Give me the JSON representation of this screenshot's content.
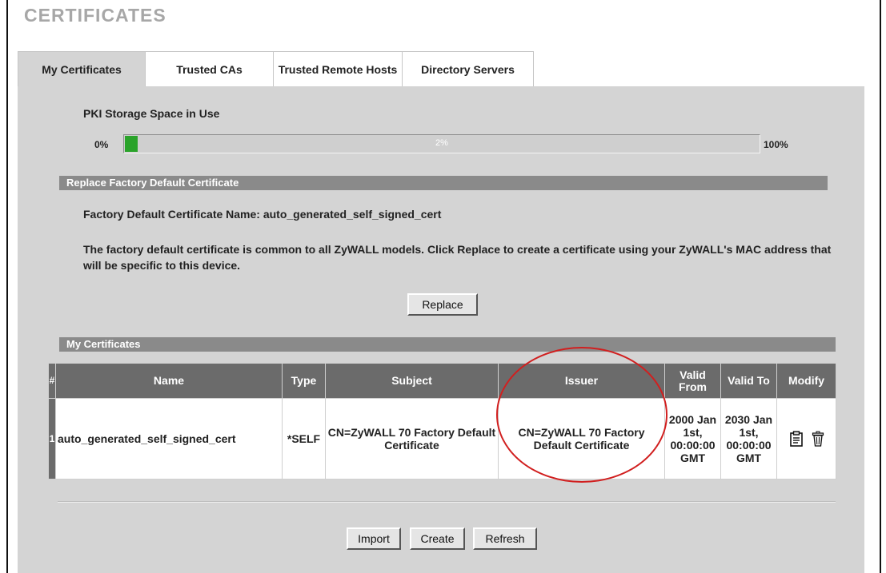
{
  "page": {
    "title": "CERTIFICATES"
  },
  "tabs": [
    {
      "label": "My Certificates",
      "active": true
    },
    {
      "label": "Trusted CAs"
    },
    {
      "label": "Trusted Remote Hosts"
    },
    {
      "label": "Directory Servers"
    }
  ],
  "pki": {
    "label": "PKI Storage Space in Use",
    "min_label": "0%",
    "max_label": "100%",
    "used_label": "2%",
    "used_fraction": 0.02
  },
  "replace_section": {
    "header": "Replace Factory Default Certificate",
    "name_line": "Factory Default Certificate Name: auto_generated_self_signed_cert",
    "description": "The factory default certificate is common to all ZyWALL models. Click Replace to create a certificate using your ZyWALL's MAC address that will be specific to this device.",
    "replace_button": "Replace"
  },
  "my_certificates": {
    "header": "My Certificates",
    "columns": [
      "#",
      "Name",
      "Type",
      "Subject",
      "Issuer",
      "Valid From",
      "Valid To",
      "Modify"
    ],
    "rows": [
      {
        "num": "1",
        "name": "auto_generated_self_signed_cert",
        "type": "*SELF",
        "subject": "CN=ZyWALL 70 Factory Default Certificate",
        "issuer": "CN=ZyWALL 70 Factory Default Certificate",
        "valid_from": "2000 Jan 1st, 00:00:00 GMT",
        "valid_to": "2030 Jan 1st, 00:00:00 GMT",
        "modify_icons": [
          "edit-icon",
          "delete-icon"
        ]
      }
    ]
  },
  "actions": {
    "import": "Import",
    "create": "Create",
    "refresh": "Refresh"
  },
  "colors": {
    "progress_fill": "#2aa32a",
    "table_header": "#6b6b6b",
    "section_header": "#8a8a8a",
    "highlight": "#d11f1f"
  }
}
